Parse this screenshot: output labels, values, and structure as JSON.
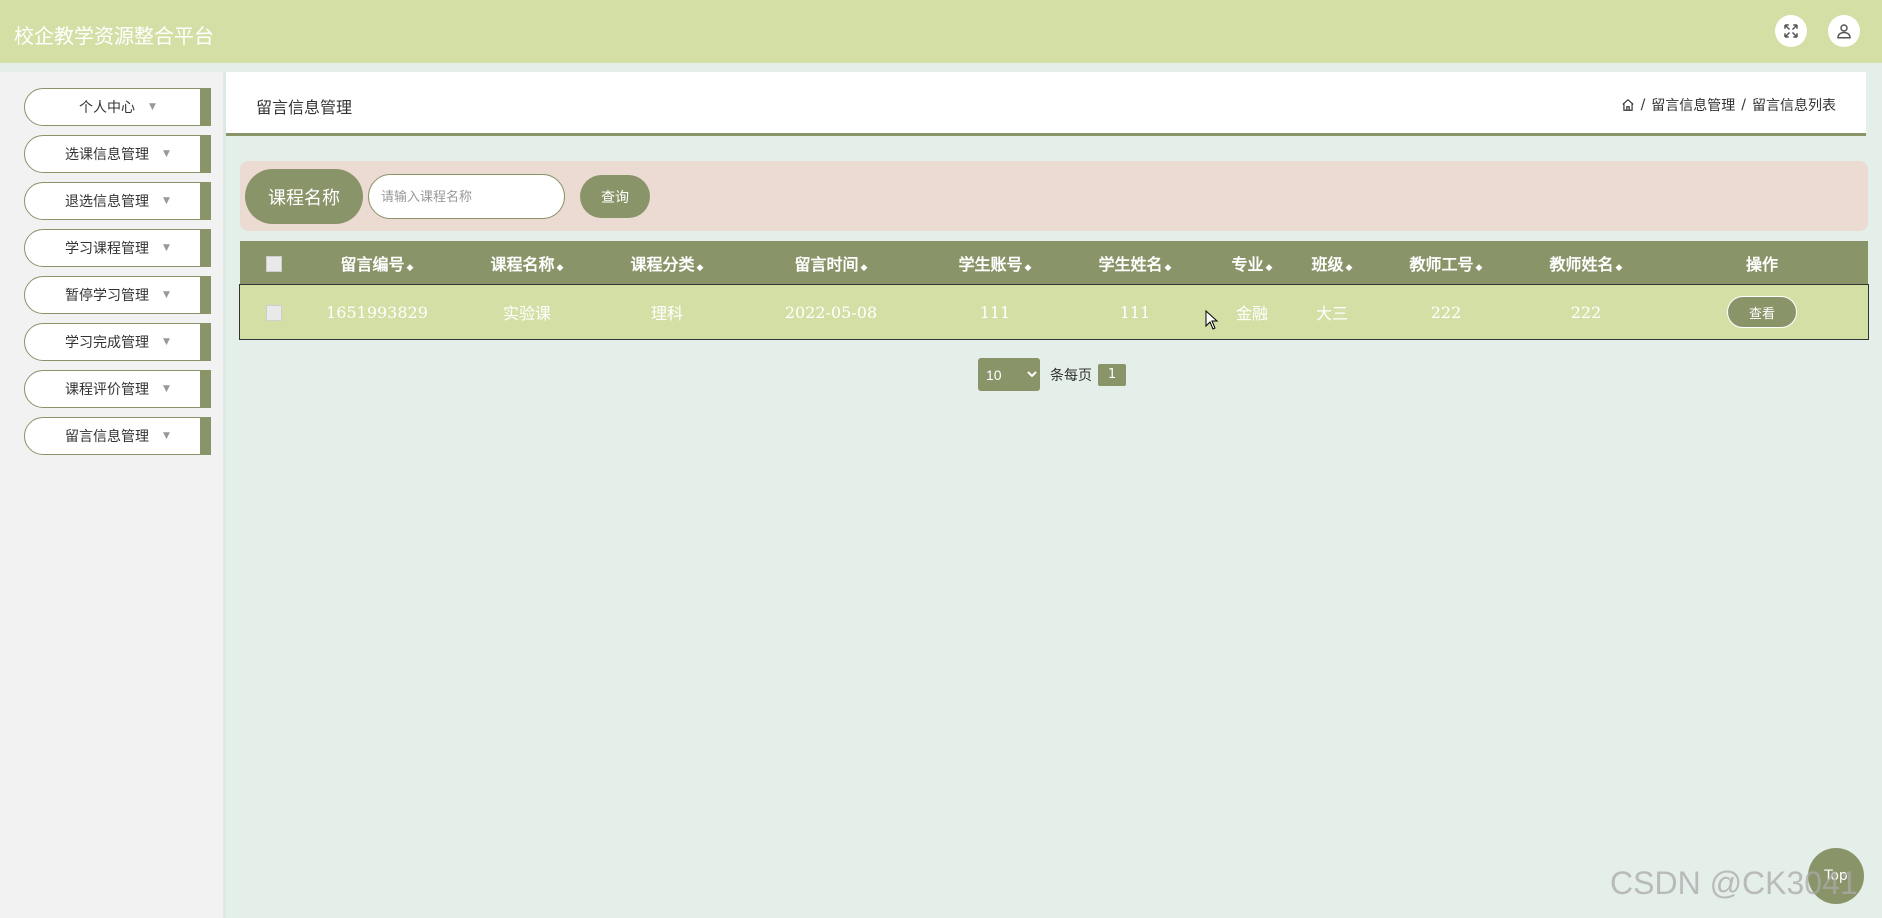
{
  "header": {
    "title": "校企教学资源整合平台",
    "fullscreen_icon": "expand-icon",
    "user_icon": "user-icon"
  },
  "sidebar": {
    "items": [
      {
        "label": "个人中心"
      },
      {
        "label": "选课信息管理"
      },
      {
        "label": "退选信息管理"
      },
      {
        "label": "学习课程管理"
      },
      {
        "label": "暂停学习管理"
      },
      {
        "label": "学习完成管理"
      },
      {
        "label": "课程评价管理"
      },
      {
        "label": "留言信息管理"
      }
    ]
  },
  "main": {
    "page_title": "留言信息管理",
    "breadcrumb": [
      "留言信息管理",
      "留言信息列表"
    ],
    "breadcrumb_sep": "/",
    "search": {
      "label": "课程名称",
      "placeholder": "请输入课程名称",
      "value": "",
      "button": "查询"
    },
    "table": {
      "columns": [
        "留言编号",
        "课程名称",
        "课程分类",
        "留言时间",
        "学生账号",
        "学生姓名",
        "专业",
        "班级",
        "教师工号",
        "教师姓名",
        "操作"
      ],
      "rows": [
        [
          "1651993829",
          "实验课",
          "理科",
          "2022-05-08",
          "111",
          "111",
          "金融",
          "大三",
          "222",
          "222"
        ]
      ],
      "action_label": "查看"
    },
    "pager": {
      "page_size": "10",
      "per_page_label": "条每页",
      "current_page": "1"
    }
  },
  "top_button": "Top",
  "watermark": "CSDN @CK3041",
  "colors": {
    "header_bg": "#d4dfa6",
    "accent": "#8a9469",
    "search_bg": "#ecdbd3",
    "content_bg": "#e5efea"
  }
}
